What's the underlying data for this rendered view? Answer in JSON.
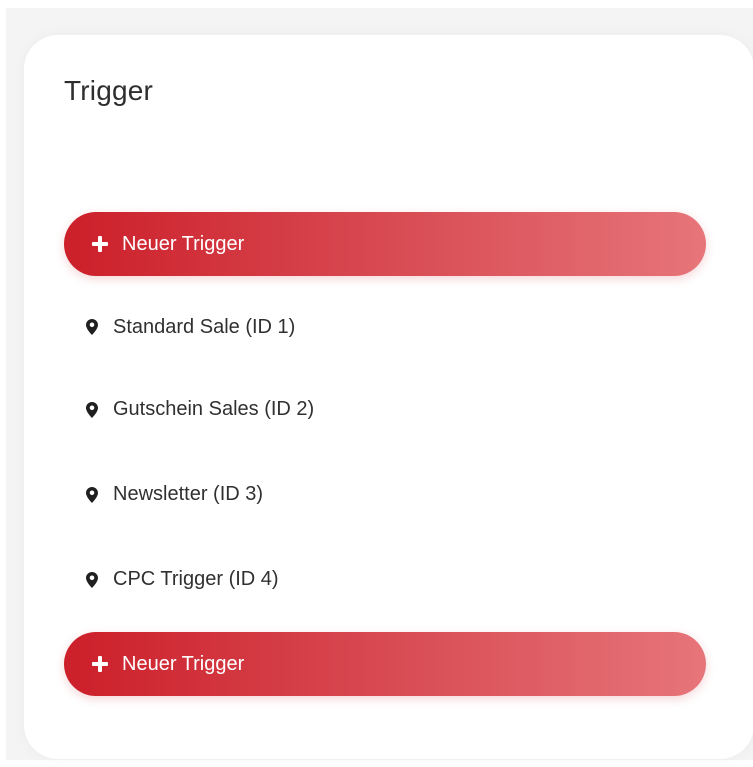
{
  "card": {
    "title": "Trigger"
  },
  "actions": {
    "new_trigger_label": "Neuer Trigger",
    "icon": "plus-icon"
  },
  "triggers": [
    {
      "label": "Standard Sale (ID 1)",
      "icon": "map-pin-icon"
    },
    {
      "label": "Gutschein Sales (ID 2)",
      "icon": "map-pin-icon"
    },
    {
      "label": "Newsletter (ID 3)",
      "icon": "map-pin-icon"
    },
    {
      "label": "CPC Trigger (ID 4)",
      "icon": "map-pin-icon"
    }
  ],
  "colors": {
    "accent_start": "#cc1f2a",
    "accent_end": "#e6757a",
    "page_background": "#f4f4f4",
    "card_background": "#ffffff"
  }
}
